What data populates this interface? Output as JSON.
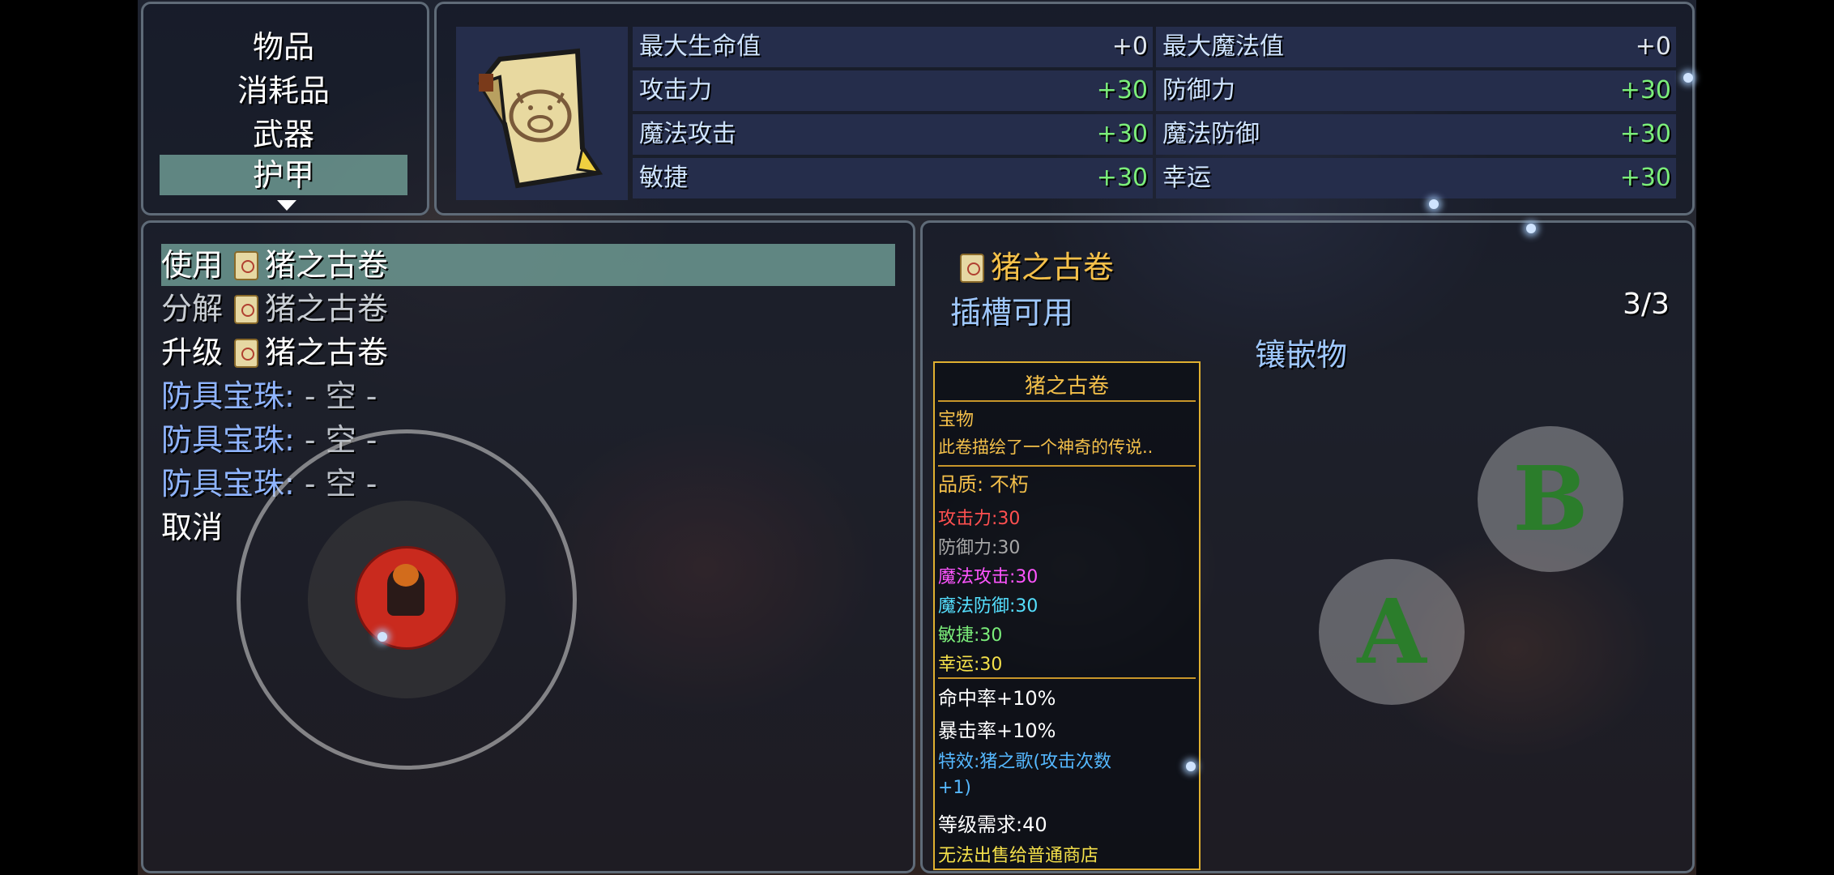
{
  "categories": {
    "items": [
      "物品",
      "消耗品",
      "武器",
      "护甲"
    ],
    "selected_index": 3
  },
  "status": {
    "rows": [
      [
        {
          "label": "最大生命值",
          "value": "+0"
        },
        {
          "label": "最大魔法值",
          "value": "+0"
        }
      ],
      [
        {
          "label": "攻击力",
          "value": "+30"
        },
        {
          "label": "防御力",
          "value": "+30"
        }
      ],
      [
        {
          "label": "魔法攻击",
          "value": "+30"
        },
        {
          "label": "魔法防御",
          "value": "+30"
        }
      ],
      [
        {
          "label": "敏捷",
          "value": "+30"
        },
        {
          "label": "幸运",
          "value": "+30"
        }
      ]
    ]
  },
  "commands": {
    "use": {
      "verb": "使用",
      "item": "猪之古卷"
    },
    "decompose": {
      "verb": "分解",
      "item": "猪之古卷"
    },
    "upgrade": {
      "verb": "升级",
      "item": "猪之古卷"
    },
    "gem_slots": [
      {
        "label": "防具宝珠:",
        "value": "- 空 -"
      },
      {
        "label": "防具宝珠:",
        "value": "- 空 -"
      },
      {
        "label": "防具宝珠:",
        "value": "- 空 -"
      }
    ],
    "cancel": "取消"
  },
  "detail": {
    "item_name": "猪之古卷",
    "slots_label": "插槽可用",
    "slots_count": "3/3",
    "inlay_label": "镶嵌物"
  },
  "tooltip": {
    "title": "猪之古卷",
    "type": "宝物",
    "desc": "此卷描绘了一个神奇的传说..",
    "quality": "品质: 不朽",
    "stats": [
      {
        "text": "攻击力:30",
        "color": "#ff5050"
      },
      {
        "text": "防御力:30",
        "color": "#a8a8a8"
      },
      {
        "text": "魔法攻击:30",
        "color": "#ff55ff"
      },
      {
        "text": "魔法防御:30",
        "color": "#55e0ff"
      },
      {
        "text": "敏捷:30",
        "color": "#7bee7a"
      },
      {
        "text": "幸运:30",
        "color": "#f4e04a"
      }
    ],
    "hit": "命中率+10%",
    "crit": "暴击率+10%",
    "special_1": "特效:猪之歌(攻击次数",
    "special_2": "+1)",
    "level_req": "等级需求:40",
    "no_sell": "无法出售给普通商店"
  },
  "buttons": {
    "a": "A",
    "b": "B"
  },
  "colors": {
    "selection": "#78aaa0",
    "gold": "#f4c04a",
    "positive": "#7bee7a",
    "gem_label": "#8fb4ff"
  }
}
